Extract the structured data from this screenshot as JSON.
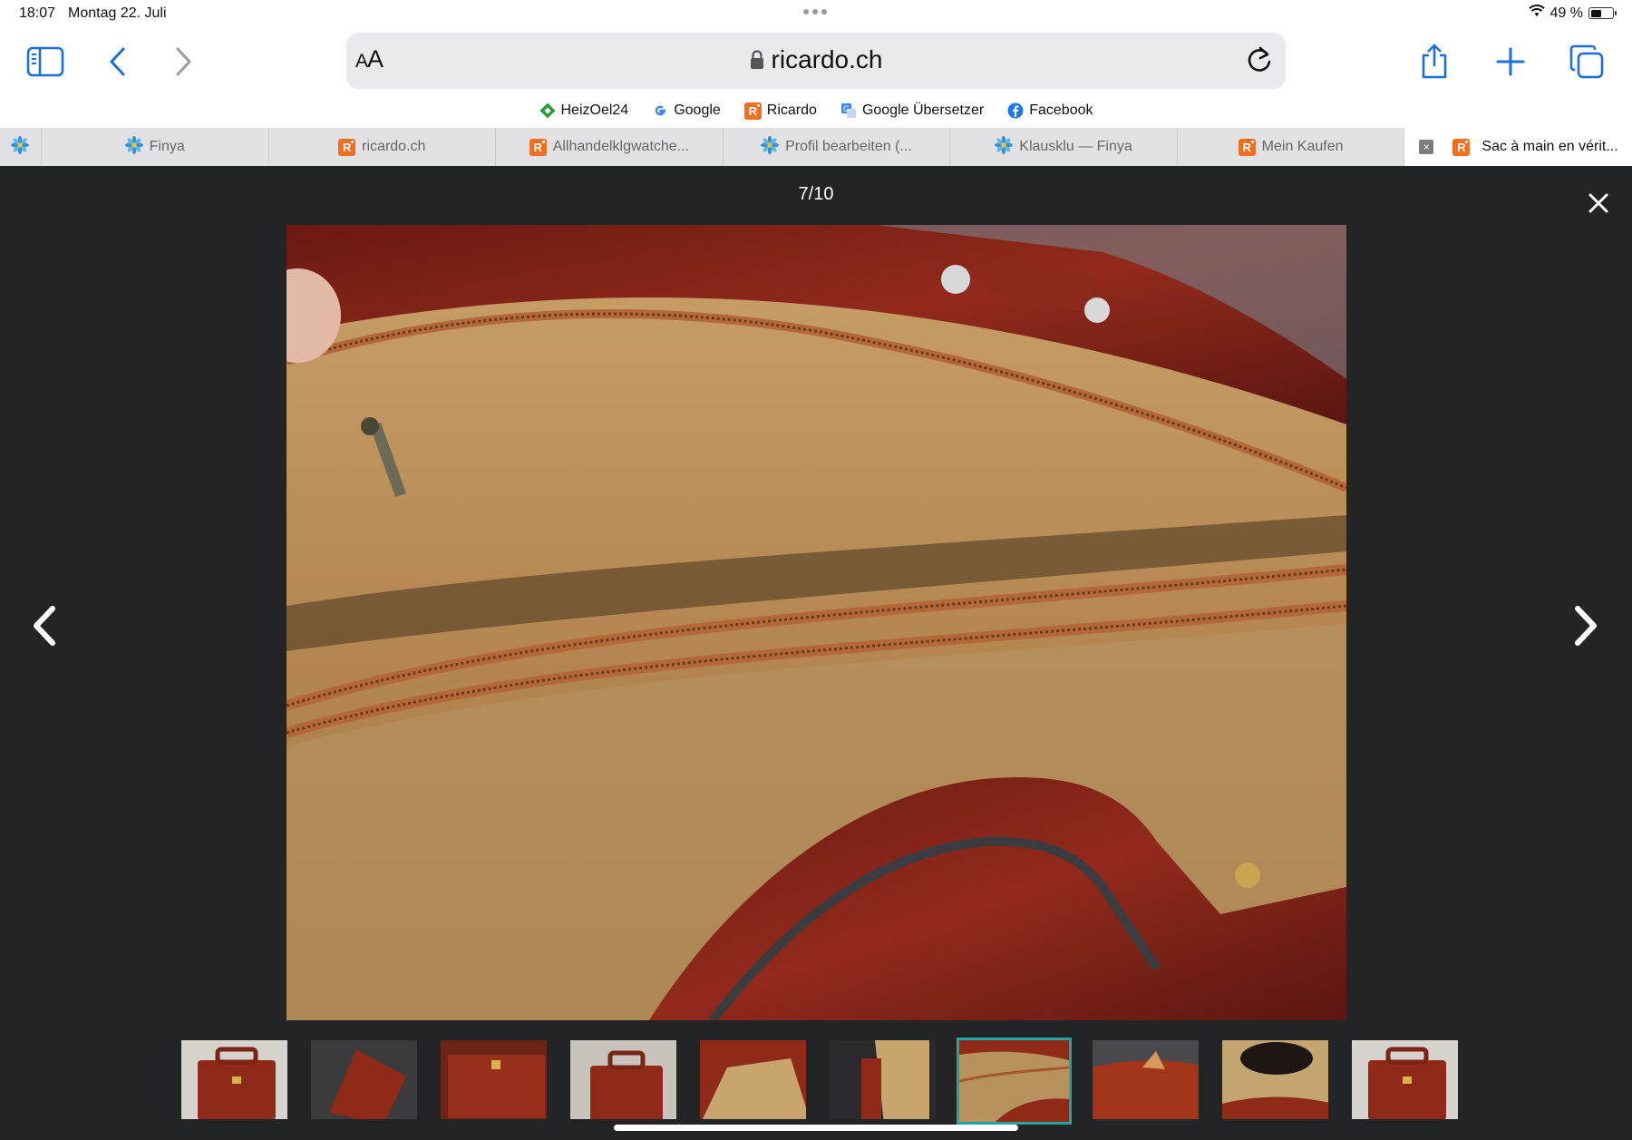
{
  "status_bar": {
    "time": "18:07",
    "date": "Montag 22. Juli",
    "battery": "49 %",
    "battery_level": 0.49
  },
  "toolbar": {
    "aa_label": "AA",
    "url": "ricardo.ch",
    "icons": [
      "sidebar-icon",
      "back-icon",
      "forward-icon",
      "lock-icon",
      "reload-icon",
      "share-icon",
      "plus-icon",
      "tabs-icon"
    ]
  },
  "favorites": [
    {
      "label": "HeizOel24",
      "icon": "heizoel-icon"
    },
    {
      "label": "Google",
      "icon": "google-icon"
    },
    {
      "label": "Ricardo",
      "icon": "ricardo-icon"
    },
    {
      "label": "Google Übersetzer",
      "icon": "translate-icon"
    },
    {
      "label": "Facebook",
      "icon": "facebook-icon"
    }
  ],
  "tabs": [
    {
      "label": "Finya",
      "icon": "finya-icon"
    },
    {
      "label": "ricardo.ch",
      "icon": "ricardo-icon"
    },
    {
      "label": "Allhandelklgwatche...",
      "icon": "ricardo-icon"
    },
    {
      "label": "Profil bearbeiten (...",
      "icon": "finya-icon"
    },
    {
      "label": "Klausklu — Finya",
      "icon": "finya-icon"
    },
    {
      "label": "Mein Kaufen",
      "icon": "ricardo-icon"
    },
    {
      "label": "Sac à main en vérit...",
      "icon": "ricardo-icon",
      "active": true
    }
  ],
  "viewer": {
    "counter": "7/10",
    "current_index": 7,
    "total": 10,
    "thumbnail_count": 10,
    "colors": {
      "background": "#232426",
      "active_thumb_border": "#1fa3a3"
    }
  }
}
